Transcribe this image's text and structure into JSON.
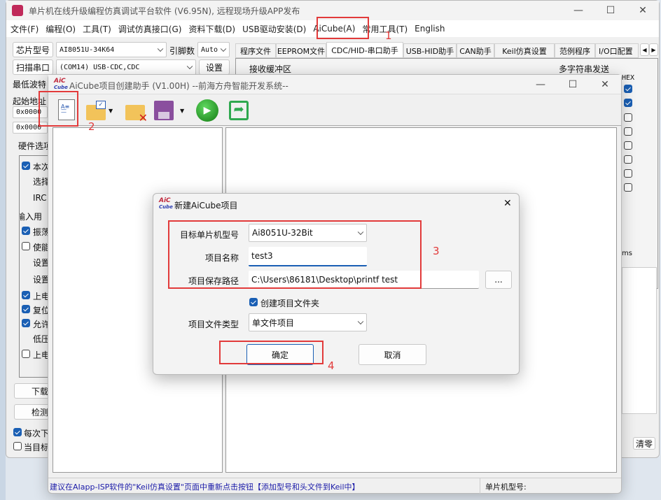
{
  "main": {
    "title": "单片机在线升级编程仿真调试平台软件 (V6.95N), 远程现场升级APP发布",
    "menu": [
      "文件(F)",
      "编程(O)",
      "工具(T)",
      "调试仿真接口(G)",
      "资料下载(D)",
      "USB驱动安装(D)",
      "AiCube(A)",
      "常用工具(T)",
      "English"
    ],
    "chip_button": "芯片型号",
    "chip_value": "AI8051U-34K64",
    "pins_label": "引脚数",
    "pins_value": "Auto",
    "scan_button": "扫描串口",
    "port_value": "(COM14) USB-CDC,CDC",
    "settings_button": "设置",
    "min_baud_label": "最低波特",
    "start_addr_label": "起始地址",
    "addr1": "0x0000",
    "addr2": "0x0000",
    "tabs": [
      "程序文件",
      "EEPROM文件",
      "CDC/HID-串口助手",
      "USB-HID助手",
      "CAN助手",
      "Keil仿真设置",
      "范例程序",
      "I/O口配置"
    ],
    "recv_buffer": "接收缓冲区",
    "multi_send": "多字符串发送",
    "hex_label": "HEX",
    "ms_label": "ms",
    "hw_tab": "硬件选项",
    "hw_items": [
      {
        "t": "本次",
        "cb": true
      },
      {
        "t": "选择",
        "cb": null
      },
      {
        "t": "IRC",
        "cb": null
      },
      {
        "t": "输入用",
        "cb": null,
        "o": true
      },
      {
        "t": "振荡",
        "cb": true
      },
      {
        "t": "使能",
        "cb": false
      },
      {
        "t": "设置",
        "cb": null
      },
      {
        "t": "设置",
        "cb": null
      },
      {
        "t": "上电",
        "cb": true
      },
      {
        "t": "复位",
        "cb": true
      },
      {
        "t": "允许",
        "cb": true
      },
      {
        "t": "低压",
        "cb": null
      },
      {
        "t": "上电",
        "cb": false
      }
    ],
    "download_button": "下载",
    "detect_button": "检测",
    "each_time": "每次下",
    "when_target": "当目标",
    "clear_button": "清零"
  },
  "aicube": {
    "title": "AiCube项目创建助手 (V1.00H) --前海方舟智能开发系统--",
    "status_hint": "建议在AIapp-ISP软件的\"Keil仿真设置\"页面中重新点击按钮【添加型号和头文件到Keil中】",
    "status_chip": "单片机型号:"
  },
  "dialog": {
    "title": "新建AiCube项目",
    "mcu_label": "目标单片机型号",
    "mcu_value": "Ai8051U-32Bit",
    "name_label": "项目名称",
    "name_value": "test3",
    "path_label": "项目保存路径",
    "path_value": "C:\\Users\\86181\\Desktop\\printf test",
    "browse": "...",
    "create_folder": "创建项目文件夹",
    "type_label": "项目文件类型",
    "type_value": "单文件项目",
    "ok": "确定",
    "cancel": "取消"
  },
  "annotations": [
    "1",
    "2",
    "3",
    "4"
  ],
  "colors": {
    "accent": "#1a5fb4",
    "annotation": "#e23a3a",
    "status_text": "#1a1aa8"
  }
}
